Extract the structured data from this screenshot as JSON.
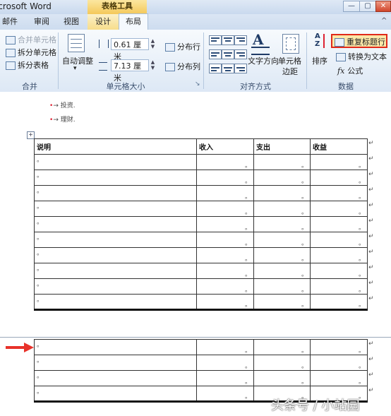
{
  "window": {
    "title": "icrosoft Word",
    "context_group": "表格工具",
    "controls": [
      "—",
      "▢",
      "✕"
    ]
  },
  "tabs": [
    {
      "label": "邮件"
    },
    {
      "label": "审阅"
    },
    {
      "label": "视图"
    },
    {
      "label": "设计"
    },
    {
      "label": "布局"
    }
  ],
  "ribbon_collapse": "^",
  "ribbon": {
    "merge_group": {
      "items": [
        {
          "label": "合并单元格",
          "enabled": false
        },
        {
          "label": "拆分单元格",
          "enabled": true
        },
        {
          "label": "拆分表格",
          "enabled": true
        }
      ],
      "label": "合并"
    },
    "cell_size_group": {
      "autofit_label": "自动调整",
      "autofit_arrow": "▾",
      "height_value": "0.61 厘米",
      "width_value": "7.13 厘米",
      "spin_up": "▲",
      "spin_down": "▼",
      "distribute_rows": "分布行",
      "distribute_cols": "分布列",
      "label": "单元格大小",
      "launcher": "↘"
    },
    "alignment_group": {
      "text_direction_label": "文字方向",
      "text_direction_glyph": "A",
      "cell_margins_label_1": "单元格",
      "cell_margins_label_2": "边距",
      "label": "对齐方式"
    },
    "data_group": {
      "sort_label": "排序",
      "sort_glyph_a": "A",
      "sort_glyph_z": "Z",
      "repeat_header": "重复标题行",
      "convert_to_text": "转换为文本",
      "formula": "公式",
      "formula_glyph": "fx",
      "label": "数据"
    }
  },
  "document": {
    "bullets": [
      {
        "marker": "•",
        "text": "投资"
      },
      {
        "marker": "•",
        "text": "理财"
      }
    ],
    "bullet_arrow": "→",
    "bullet_end": ".",
    "table_handle": "+",
    "headers": [
      "说明",
      "收入",
      "支出",
      "收益"
    ],
    "cell_mark": "。",
    "end_mark": "↵",
    "rows_page1": 10,
    "rows_page2": 4
  },
  "watermark": "头条号 / 小站园"
}
